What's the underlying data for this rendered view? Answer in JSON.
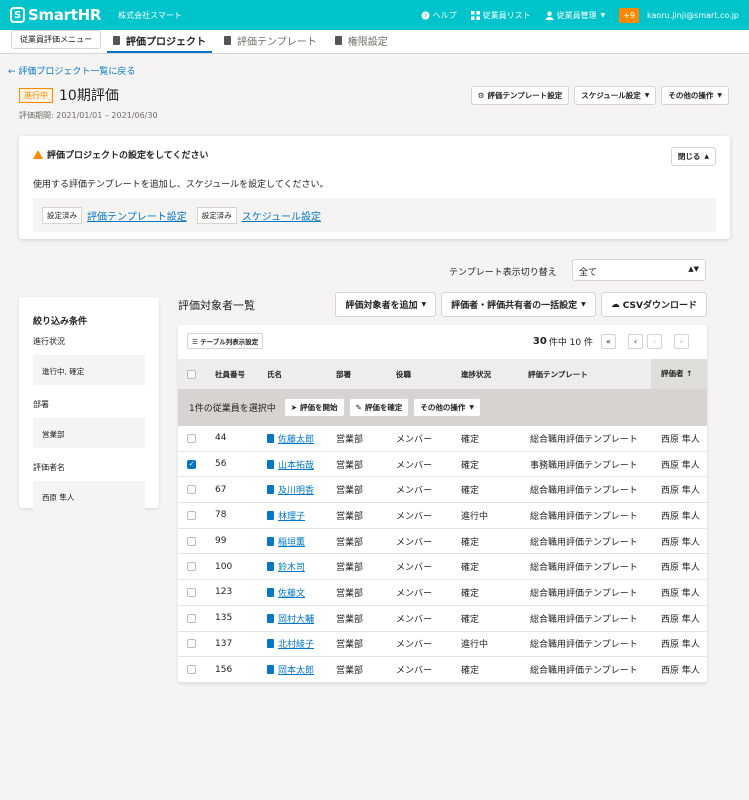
{
  "header": {
    "brand": "SmartHR",
    "company": "株式会社スマート",
    "nav": [
      "ヘルプ",
      "従業員リスト",
      "従業員管理"
    ],
    "notification_count": "+9",
    "user_email": "kaoru.jinji@smart.co.jp"
  },
  "tabs": {
    "menu_button": "従業員評価メニュー",
    "items": [
      "評価プロジェクト",
      "評価テンプレート",
      "権限設定"
    ]
  },
  "project": {
    "back_link": "評価プロジェクト一覧に戻る",
    "status": "進行中",
    "title": "10期評価",
    "period": "評価期間: 2021/01/01 – 2021/06/30",
    "actions": [
      "評価テンプレート設定",
      "スケジュール設定",
      "その他の操作"
    ]
  },
  "notice": {
    "title": "評価プロジェクトの設定をしてください",
    "close": "閉じる",
    "text": "使用する評価テンプレートを追加し、スケジュールを設定してください。",
    "done_label": "設定済み",
    "link_template": "評価テンプレート設定",
    "link_schedule": "スケジュール設定"
  },
  "template_switch": {
    "label": "テンプレート表示切り替え",
    "value": "全て"
  },
  "filter": {
    "title": "絞り込み条件",
    "fields": [
      {
        "label": "進行状況",
        "value": "進行中, 確定"
      },
      {
        "label": "部署",
        "value": "営業部"
      },
      {
        "label": "評価者名",
        "value": "西原 隼人"
      }
    ]
  },
  "list": {
    "title": "評価対象者一覧",
    "actions": [
      "評価対象者を追加",
      "評価者・評価共有者の一括設定",
      "CSVダウンロード"
    ],
    "column_settings": "テーブル列表示設定",
    "pager_total": "30",
    "pager_text": "件中 10 件",
    "columns": [
      "社員番号",
      "氏名",
      "部署",
      "役職",
      "進捗状況",
      "評価テンプレート",
      "評価者"
    ],
    "selection_text": "1件の従業員を選択中",
    "selection_actions": [
      "評価を開始",
      "評価を確定",
      "その他の操作"
    ],
    "rows": [
      {
        "no": "44",
        "name": "佐藤太郎",
        "dept": "営業部",
        "role": "メンバー",
        "status": "確定",
        "template": "総合職用評価テンプレート",
        "evaluator": "西原 隼人",
        "checked": false
      },
      {
        "no": "56",
        "name": "山本拓哉",
        "dept": "営業部",
        "role": "メンバー",
        "status": "確定",
        "template": "事務職用評価テンプレート",
        "evaluator": "西原 隼人",
        "checked": true
      },
      {
        "no": "67",
        "name": "及川明香",
        "dept": "営業部",
        "role": "メンバー",
        "status": "確定",
        "template": "総合職用評価テンプレート",
        "evaluator": "西原 隼人",
        "checked": false
      },
      {
        "no": "78",
        "name": "林理子",
        "dept": "営業部",
        "role": "メンバー",
        "status": "進行中",
        "template": "総合職用評価テンプレート",
        "evaluator": "西原 隼人",
        "checked": false
      },
      {
        "no": "99",
        "name": "稲垣薫",
        "dept": "営業部",
        "role": "メンバー",
        "status": "確定",
        "template": "総合職用評価テンプレート",
        "evaluator": "西原 隼人",
        "checked": false
      },
      {
        "no": "100",
        "name": "鈴木司",
        "dept": "営業部",
        "role": "メンバー",
        "status": "確定",
        "template": "総合職用評価テンプレート",
        "evaluator": "西原 隼人",
        "checked": false
      },
      {
        "no": "123",
        "name": "佐藤文",
        "dept": "営業部",
        "role": "メンバー",
        "status": "確定",
        "template": "総合職用評価テンプレート",
        "evaluator": "西原 隼人",
        "checked": false
      },
      {
        "no": "135",
        "name": "岡村大輔",
        "dept": "営業部",
        "role": "メンバー",
        "status": "確定",
        "template": "総合職用評価テンプレート",
        "evaluator": "西原 隼人",
        "checked": false
      },
      {
        "no": "137",
        "name": "北村綾子",
        "dept": "営業部",
        "role": "メンバー",
        "status": "進行中",
        "template": "総合職用評価テンプレート",
        "evaluator": "西原 隼人",
        "checked": false
      },
      {
        "no": "156",
        "name": "岡本太郎",
        "dept": "営業部",
        "role": "メンバー",
        "status": "確定",
        "template": "総合職用評価テンプレート",
        "evaluator": "西原 隼人",
        "checked": false
      }
    ]
  }
}
